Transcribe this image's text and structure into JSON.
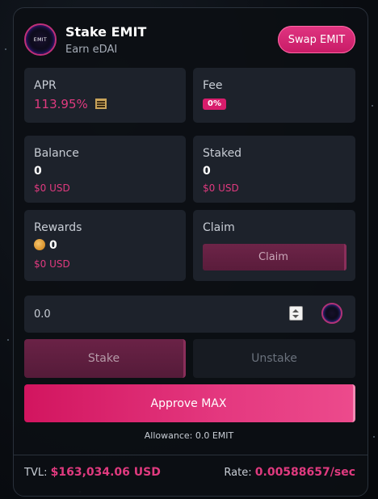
{
  "header": {
    "logo_text": "EMIT",
    "title": "Stake EMIT",
    "subtitle": "Earn eDAI",
    "swap_label": "Swap EMIT"
  },
  "stats": {
    "apr": {
      "label": "APR",
      "value": "113.95%",
      "icon": "abacus-icon"
    },
    "fee": {
      "label": "Fee",
      "value": "0%"
    },
    "balance": {
      "label": "Balance",
      "value": "0",
      "usd": "$0 USD"
    },
    "staked": {
      "label": "Staked",
      "value": "0",
      "usd": "$0 USD"
    },
    "rewards": {
      "label": "Rewards",
      "value": "0",
      "usd": "$0 USD",
      "icon": "coin-icon"
    },
    "claim": {
      "label": "Claim",
      "button": "Claim"
    }
  },
  "amount": {
    "value": "0.0",
    "token_icon": "emit-token-icon"
  },
  "actions": {
    "stake": "Stake",
    "unstake": "Unstake",
    "approve": "Approve MAX",
    "allowance": "Allowance: 0.0 EMIT"
  },
  "footer": {
    "tvl_label": "TVL:",
    "tvl_value": "$163,034.06 USD",
    "rate_label": "Rate:",
    "rate_value": "0.00588657/sec"
  },
  "colors": {
    "accent": "#e03a7f",
    "tile_bg": "#1d222b",
    "card_bg": "#0c0f14"
  }
}
